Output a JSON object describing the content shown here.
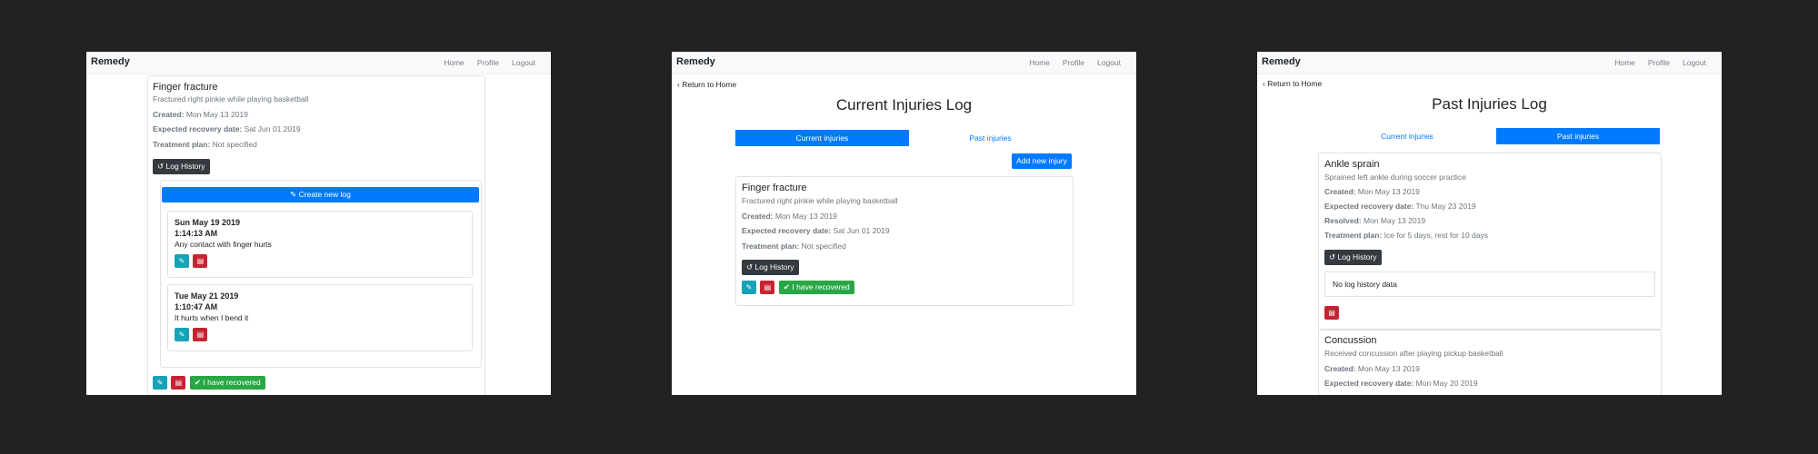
{
  "navbar": {
    "brand": "Remedy",
    "links": [
      "Home",
      "Profile",
      "Logout"
    ]
  },
  "icons": {
    "edit": "edit-icon",
    "trash": "trash-icon",
    "check": "check-icon",
    "history": "history-icon",
    "chevron": "chevron-left-icon"
  },
  "colors": {
    "primary": "#007bff",
    "teal": "#17a2b8",
    "danger": "#c82333",
    "success": "#28a745",
    "dark": "#343a40"
  },
  "screen1": {
    "injury": {
      "title": "Finger fracture",
      "description": "Fractured right pinkie while playing basketball",
      "created_label": "Created:",
      "created_value": "Mon May 13 2019",
      "expected_label": "Expected recovery date:",
      "expected_value": "Sat Jun 01 2019",
      "plan_label": "Treatment plan:",
      "plan_value": "Not specified"
    },
    "log_history_label": "Log History",
    "create_log_label": "Create new log",
    "logs": [
      {
        "date": "Sun May 19 2019",
        "time": "1:14:13 AM",
        "note": "Any contact with finger hurts"
      },
      {
        "date": "Tue May 21 2019",
        "time": "1:10:47 AM",
        "note": "It hurts when I bend it"
      }
    ],
    "recovered_label": "I have recovered"
  },
  "screen2": {
    "back_label": "Return to Home",
    "heading": "Current Injuries Log",
    "tabs": [
      "Current injuries",
      "Past injuries"
    ],
    "add_label": "Add new injury",
    "injury": {
      "title": "Finger fracture",
      "description": "Fractured right pinkie while playing basketball",
      "created_label": "Created:",
      "created_value": "Mon May 13 2019",
      "expected_label": "Expected recovery date:",
      "expected_value": "Sat Jun 01 2019",
      "plan_label": "Treatment plan:",
      "plan_value": "Not specified"
    },
    "log_history_label": "Log History",
    "recovered_label": "I have recovered"
  },
  "screen3": {
    "back_label": "Return to Home",
    "heading": "Past Injuries Log",
    "tabs": [
      "Current injuries",
      "Past injuries"
    ],
    "injury1": {
      "title": "Ankle sprain",
      "description": "Sprained left ankle during soccer practice",
      "created_label": "Created:",
      "created_value": "Mon May 13 2019",
      "expected_label": "Expected recovery date:",
      "expected_value": "Thu May 23 2019",
      "resolved_label": "Resolved:",
      "resolved_value": "Mon May 13 2019",
      "plan_label": "Treatment plan:",
      "plan_value": "Ice for 5 days, rest for 10 days"
    },
    "log_history_label": "Log History",
    "no_history": "No log history data",
    "injury2": {
      "title": "Concussion",
      "description": "Received concussion after playing pickup basketball",
      "created_label": "Created:",
      "created_value": "Mon May 13 2019",
      "expected_label": "Expected recovery date:",
      "expected_value": "Mon May 20 2019"
    }
  }
}
